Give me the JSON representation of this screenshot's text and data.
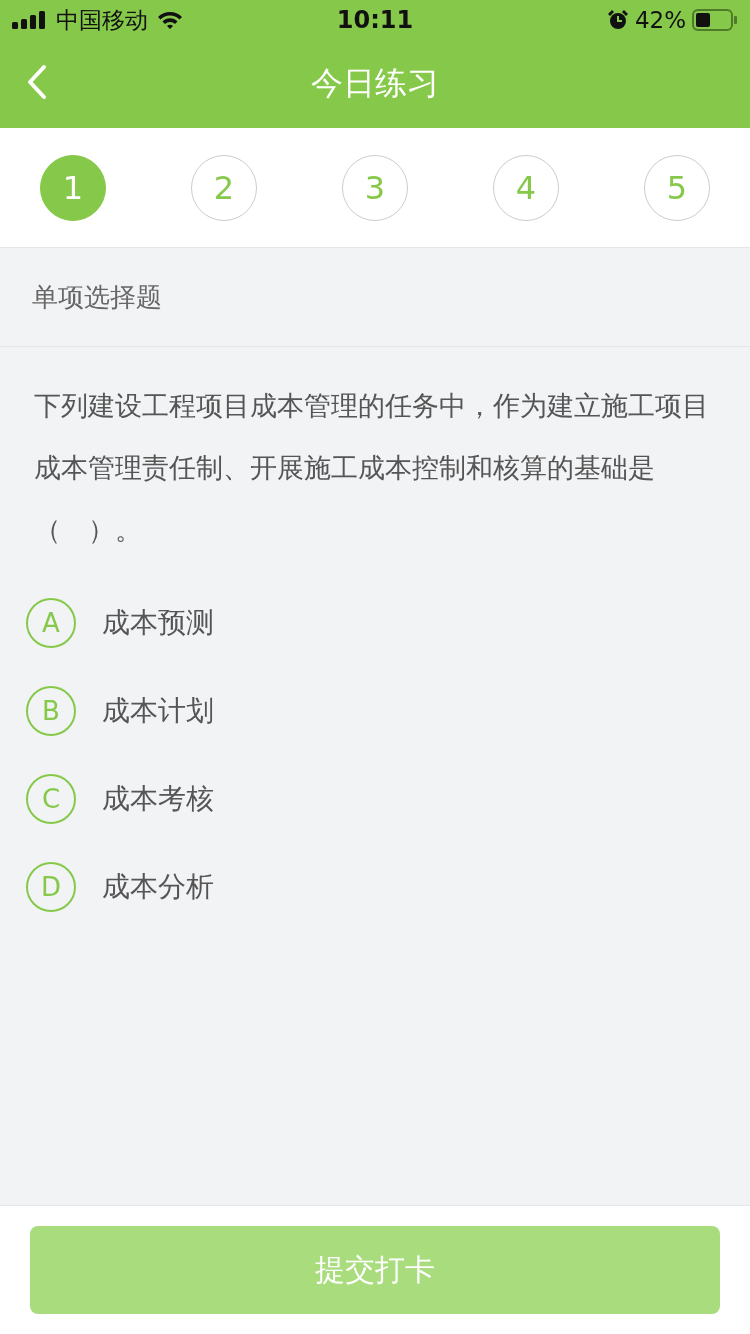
{
  "status_bar": {
    "carrier": "中国移动",
    "time": "10:11",
    "battery": "42%"
  },
  "nav": {
    "title": "今日练习"
  },
  "steps": [
    {
      "label": "1",
      "selected": true
    },
    {
      "label": "2",
      "selected": false
    },
    {
      "label": "3",
      "selected": false
    },
    {
      "label": "4",
      "selected": false
    },
    {
      "label": "5",
      "selected": false
    }
  ],
  "section": {
    "title": "单项选择题"
  },
  "question": {
    "text": "下列建设工程项目成本管理的任务中，作为建立施工项目成本管理责任制、开展施工成本控制和核算的基础是（　）。",
    "options": [
      {
        "letter": "A",
        "text": "成本预测",
        "selected": false
      },
      {
        "letter": "B",
        "text": "成本计划",
        "selected": false
      },
      {
        "letter": "C",
        "text": "成本考核",
        "selected": false
      },
      {
        "letter": "D",
        "text": "成本分析",
        "selected": false
      }
    ]
  },
  "submit": {
    "label": "提交打卡",
    "disabled": true
  }
}
